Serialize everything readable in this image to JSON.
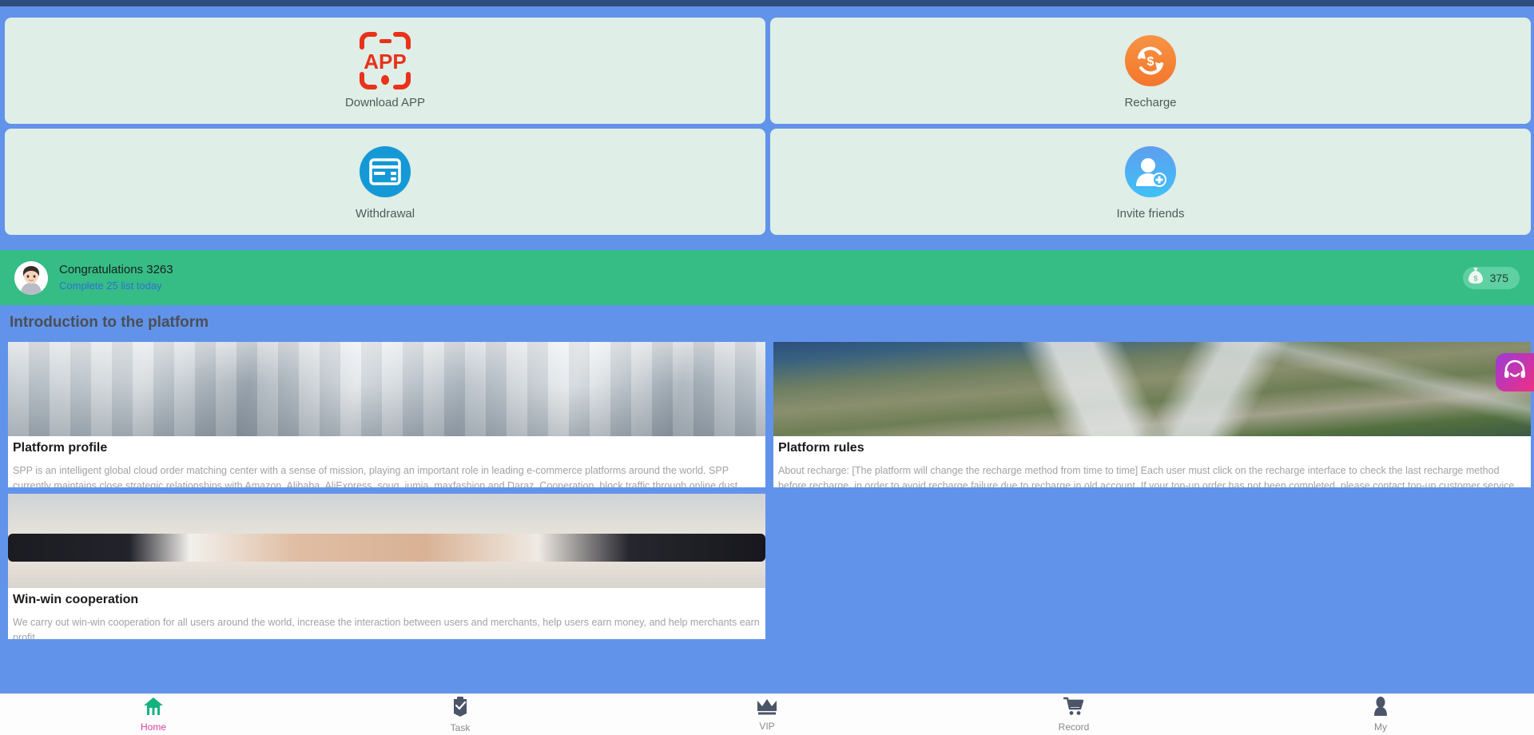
{
  "theme": {
    "background": "#6293ea",
    "card_bg": "#dfeee6",
    "green_bar": "#35bd85",
    "active_nav": "#d6409f",
    "top_strip": "#2f4e7e"
  },
  "quick_actions": [
    {
      "label": "Download APP",
      "icon": "app-download-icon",
      "color": "#e8321b"
    },
    {
      "label": "Recharge",
      "icon": "recharge-icon",
      "color": "#f4762c"
    },
    {
      "label": "Withdrawal",
      "icon": "withdrawal-card-icon",
      "color": "#1599d6"
    },
    {
      "label": "Invite friends",
      "icon": "invite-friends-icon",
      "color": "#3fc1f7"
    }
  ],
  "congrats": {
    "avatar": "user-avatar",
    "title": "Congratulations 3263",
    "subtitle": "Complete 25 list today",
    "coin_icon": "money-bag-icon",
    "coin_value": "375"
  },
  "section": {
    "title": "Introduction to the platform"
  },
  "info_cards": [
    {
      "title": "Platform profile",
      "text": "SPP is an intelligent global cloud order matching center with a sense of mission, playing an important role in leading e-commerce platforms around the world. SPP currently maintains close strategic relationships with Amazon, Alibaba, AliExpress, souq, jumia, maxfashion and Daraz. Cooperation, block traffic through online dust absorption, updat…",
      "photo": "office-interior-photo"
    },
    {
      "title": "Platform rules",
      "text": "About recharge: [The platform will change the recharge method from time to time] Each user must click on the recharge interface to check the last recharge method before recharge, in order to avoid recharge failure due to recharge in old account. If your top-up order has not been completed, please contact top-up customer service for consultati…",
      "photo": "aerial-highway-photo"
    },
    {
      "title": "Win-win cooperation",
      "text": "We carry out win-win cooperation for all users around the world, increase the interaction between users and merchants, help users earn money, and help merchants earn profit.",
      "photo": "handshake-photo"
    }
  ],
  "floating_button": {
    "icon": "customer-service-headset-icon",
    "label": "Customer service"
  },
  "bottom_nav": [
    {
      "label": "Home",
      "icon": "home-icon",
      "active": true
    },
    {
      "label": "Task",
      "icon": "clipboard-task-icon",
      "active": false
    },
    {
      "label": "VIP",
      "icon": "crown-icon",
      "active": false
    },
    {
      "label": "Record",
      "icon": "shopping-cart-icon",
      "active": false
    },
    {
      "label": "My",
      "icon": "person-icon",
      "active": false
    }
  ]
}
